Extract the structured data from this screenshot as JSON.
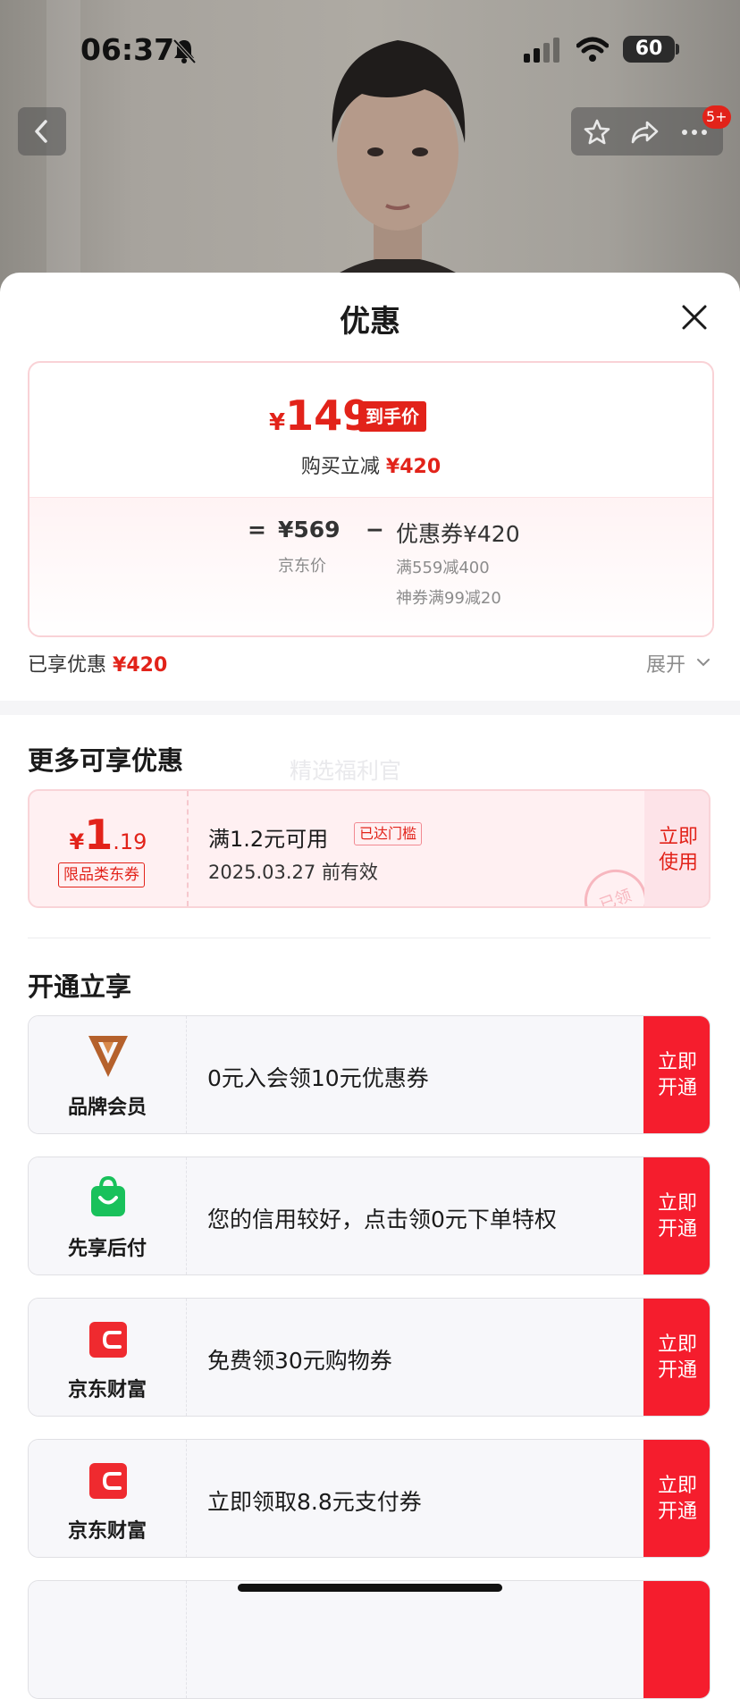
{
  "status_bar": {
    "time": "06:37",
    "battery": "60"
  },
  "product_nav": {
    "badge": "5+"
  },
  "sheet": {
    "title": "优惠",
    "price_card": {
      "final_price_symbol": "¥",
      "final_price": "149",
      "final_price_tag": "到手价",
      "reduce_label": "购买立减",
      "reduce_amount": "¥420",
      "equals": "=",
      "jd_price": "¥569",
      "jd_price_label": "京东价",
      "minus": "−",
      "coupon_label": "优惠券¥420",
      "coupon_detail_1": "满559减400",
      "coupon_detail_2": "神券满99减20"
    },
    "enjoyed_label": "已享优惠",
    "enjoyed_amount": "¥420",
    "expand_label": "展开"
  },
  "more_section": {
    "title": "更多可享优惠",
    "watermark": "精选福利官",
    "coupon": {
      "symbol": "¥",
      "integer": "1",
      "decimal": ".19",
      "kind": "限品类东券",
      "condition": "满1.2元可用",
      "reached": "已达门槛",
      "valid_until": "2025.03.27 前有效",
      "use_label": "立即使用",
      "stamp": "已领"
    }
  },
  "open_section": {
    "title": "开通立享",
    "offers": [
      {
        "name": "品牌会员",
        "icon": "brand-member-v-icon",
        "desc": "0元入会领10元优惠券",
        "button": "立即开通"
      },
      {
        "name": "先享后付",
        "icon": "shopping-bag-icon",
        "desc": "您的信用较好，点击领0元下单特权",
        "button": "立即开通"
      },
      {
        "name": "京东财富",
        "icon": "jd-wallet-icon",
        "desc": "免费领30元购物券",
        "button": "立即开通"
      },
      {
        "name": "京东财富",
        "icon": "jd-wallet-icon",
        "desc": "立即领取8.8元支付券",
        "button": "立即开通"
      }
    ]
  },
  "colors": {
    "accent": "#e2231a",
    "button_red": "#f51d2d",
    "member_gold": "#b5612c",
    "pay_green": "#19c15b"
  }
}
